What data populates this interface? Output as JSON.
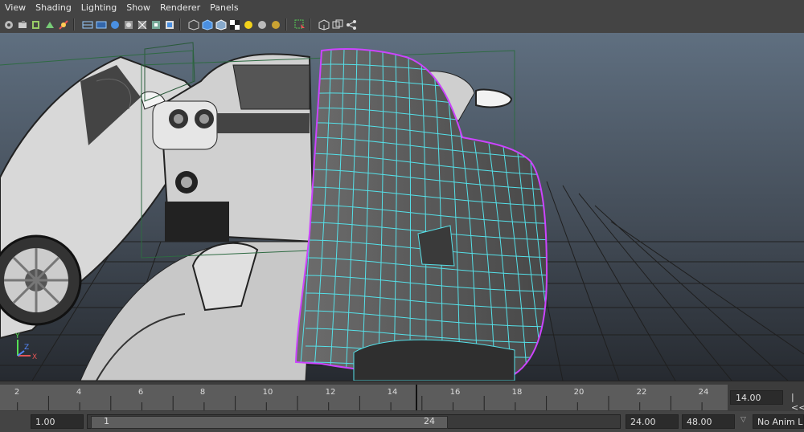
{
  "menu": [
    "View",
    "Shading",
    "Lighting",
    "Show",
    "Renderer",
    "Panels"
  ],
  "toolbar": {
    "icons": [
      "camera-select-icon",
      "camera-attributes-icon",
      "bookmark-icon",
      "image-plane-icon",
      "grid-toggle-icon",
      "wireframe-icon",
      "smooth-shade-icon",
      "default-light-icon",
      "textured-icon",
      "xray-icon",
      "isolate-icon",
      "two-sided-icon",
      "cube-wire-icon",
      "cube-smooth-icon",
      "cube-shaded-icon",
      "checker-icon",
      "light-yellow-icon",
      "light-grey-icon",
      "light-gold-icon",
      "select-camera-icon",
      "box-icon",
      "box-outline-icon",
      "hypergraph-icon"
    ]
  },
  "timeline": {
    "ticks": [
      "2",
      "4",
      "6",
      "8",
      "10",
      "12",
      "14",
      "16",
      "18",
      "20",
      "22",
      "24"
    ],
    "current_frame": "14.00",
    "playback_prefix": "|<<"
  },
  "range": {
    "start_time": "1.00",
    "slider_start": "1",
    "slider_end": "24",
    "end_time": "24.00",
    "anim_end": "48.00",
    "anim_layer": "No Anim Layer"
  },
  "axis": {
    "y": "Y",
    "x": "X",
    "z": "Z"
  },
  "colors": {
    "mesh": "#55e0e8",
    "mesh_edge": "#cc44ff",
    "viewport_top": "#5d6d7e",
    "viewport_bottom": "#2a2f36"
  }
}
